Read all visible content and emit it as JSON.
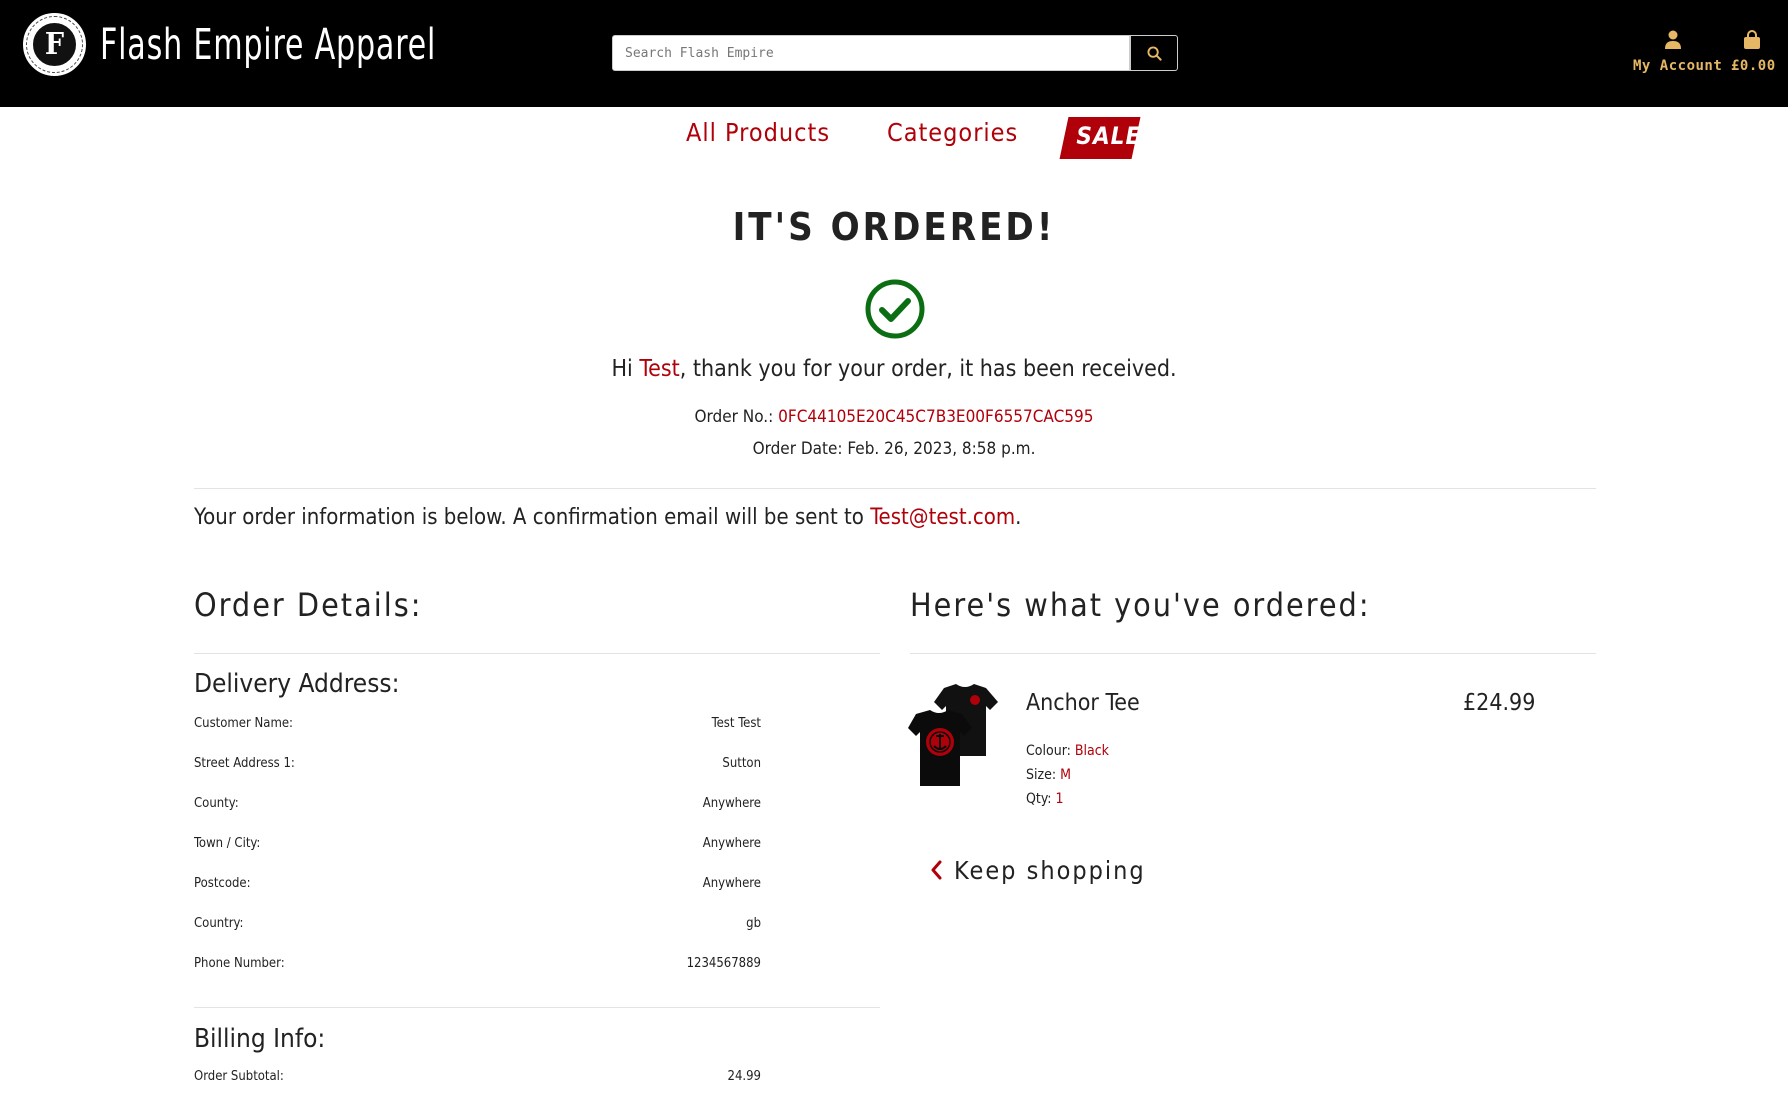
{
  "header": {
    "logo_letter": "F",
    "logo_ring_text": "FLASH EMPIRE APPAREL",
    "brand": "Flash Empire Apparel",
    "search_placeholder": "Search Flash Empire",
    "account_label": "My Account",
    "cart_label": "£0.00",
    "accent": "#e6b865"
  },
  "nav": {
    "all_products": "All Products",
    "categories": "Categories",
    "sale": "SALE"
  },
  "confirmation": {
    "title": "IT'S ORDERED!",
    "hi": "Hi",
    "name": "Test",
    "thanks_rest": ", thank you for your order, it has been received.",
    "order_no_label": "Order No.:",
    "order_no": "0FC44105E20C45C7B3E00F6557CAC595",
    "order_date": "Order Date: Feb. 26, 2023, 8:58 p.m.",
    "info_text": "Your order information is below. A confirmation email will be sent to",
    "email": "Test@test.com",
    "info_end": "."
  },
  "order_details": {
    "heading": "Order Details:",
    "delivery_heading": "Delivery Address:",
    "delivery_rows": [
      {
        "label": "Customer Name:",
        "value": "Test Test"
      },
      {
        "label": "Street Address 1:",
        "value": "Sutton"
      },
      {
        "label": "County:",
        "value": "Anywhere"
      },
      {
        "label": "Town / City:",
        "value": "Anywhere"
      },
      {
        "label": "Postcode:",
        "value": "Anywhere"
      },
      {
        "label": "Country:",
        "value": "gb"
      },
      {
        "label": "Phone Number:",
        "value": "1234567889"
      }
    ],
    "billing_heading": "Billing Info:",
    "billing_rows": [
      {
        "label": "Order Subtotal:",
        "value": "24.99"
      }
    ]
  },
  "ordered": {
    "heading": "Here's what you've ordered:",
    "item": {
      "name": "Anchor Tee",
      "price": "£24.99",
      "colour_label": "Colour:",
      "colour": "Black",
      "size_label": "Size:",
      "size": "M",
      "qty_label": "Qty:",
      "qty": "1"
    },
    "keep_shopping": "Keep shopping"
  },
  "colors": {
    "brand_red": "#b0000a",
    "success_green": "#0c6e12",
    "header_bg": "#000000"
  }
}
